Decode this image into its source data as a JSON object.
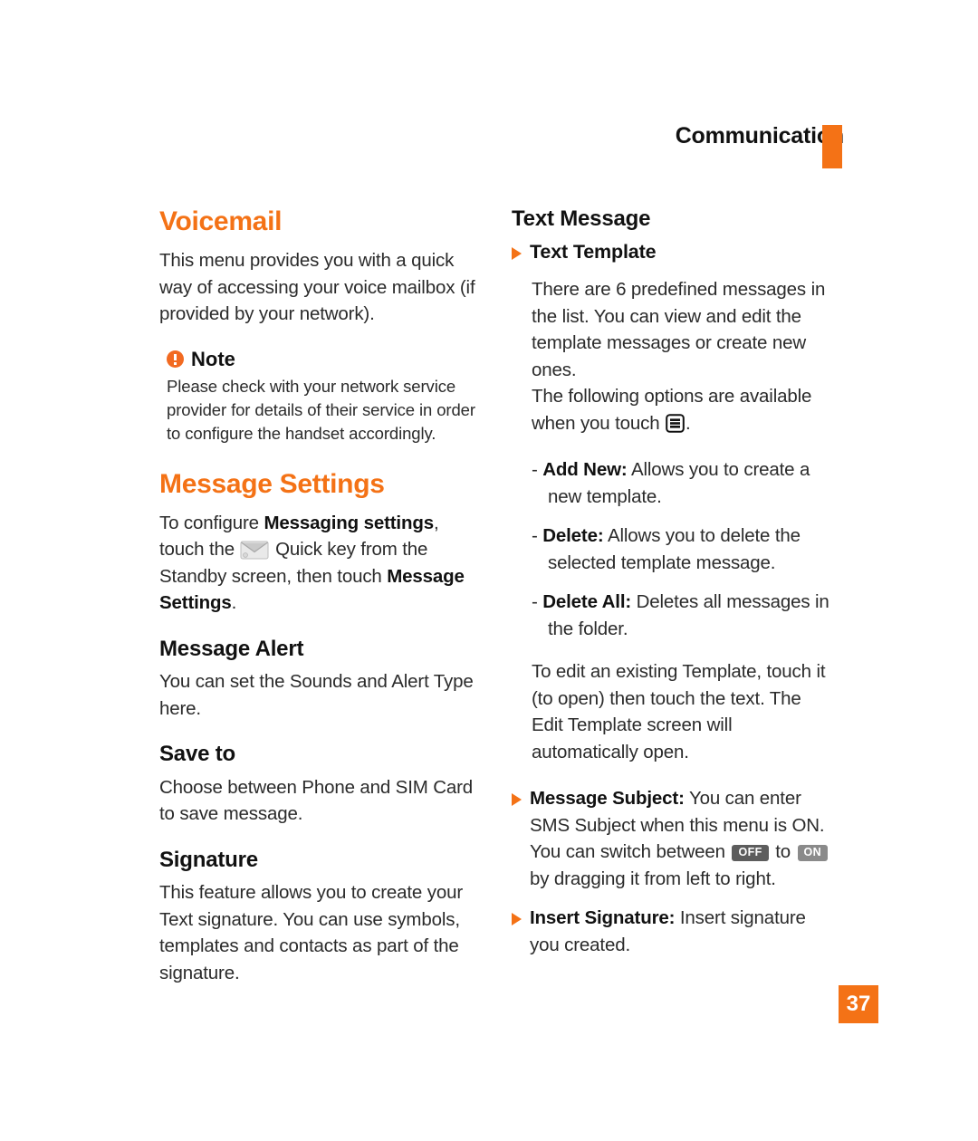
{
  "header": {
    "chapter": "Communication",
    "rule_color": "#f47216"
  },
  "left_column": {
    "voicemail": {
      "title": "Voicemail",
      "body": "This menu provides you with a quick way of accessing your voice mailbox (if provided by your network)."
    },
    "note": {
      "icon": "alert-circle-icon",
      "label": "Note",
      "body": "Please check with your network service provider for details of their service in order to configure the handset accordingly."
    },
    "message_settings": {
      "title": "Message Settings",
      "para_part1": "To configure ",
      "para_bold1": "Messaging settings",
      "para_part2": ", touch the ",
      "icon": "envelope-icon",
      "para_part3": " Quick key from the Standby screen, then touch ",
      "para_bold2": "Message Settings",
      "para_part4": "."
    },
    "message_alert": {
      "title": "Message Alert",
      "body": "You can set the Sounds and Alert Type here."
    },
    "save_to": {
      "title": "Save to",
      "body": "Choose between Phone and SIM Card to save message."
    },
    "signature": {
      "title": "Signature",
      "body": "This feature allows you to create your Text signature. You can use symbols, templates and contacts as part of the signature."
    }
  },
  "right_column": {
    "text_message": {
      "title": "Text Message"
    },
    "text_template": {
      "bullet": "triangle-bullet-icon",
      "heading": "Text Template",
      "para1": "There are 6 predefined messages in the list. You can view and edit the template messages or create new ones.",
      "para2_part1": "The following options are available when you touch ",
      "menu_icon": "menu-icon",
      "para2_part2": ".",
      "options": [
        {
          "label": "Add New:",
          "desc": " Allows you to create a new template."
        },
        {
          "label": "Delete:",
          "desc": " Allows you to delete the selected template message."
        },
        {
          "label": "Delete All:",
          "desc": " Deletes all messages in the folder."
        }
      ],
      "para3": "To edit an existing Template, touch it (to open) then touch the text. The Edit Template screen will automatically open."
    },
    "message_subject": {
      "bullet": "triangle-bullet-icon",
      "label": "Message Subject:",
      "part1": " You can enter SMS Subject when this menu is ON. You can switch between ",
      "badge_off": "OFF",
      "part2": " to ",
      "badge_on": "ON",
      "part3": " by dragging it from left to right."
    },
    "insert_signature": {
      "bullet": "triangle-bullet-icon",
      "label": "Insert Signature:",
      "desc": " Insert signature you created."
    }
  },
  "footer": {
    "page_number": "37",
    "badge_color": "#f47216"
  }
}
